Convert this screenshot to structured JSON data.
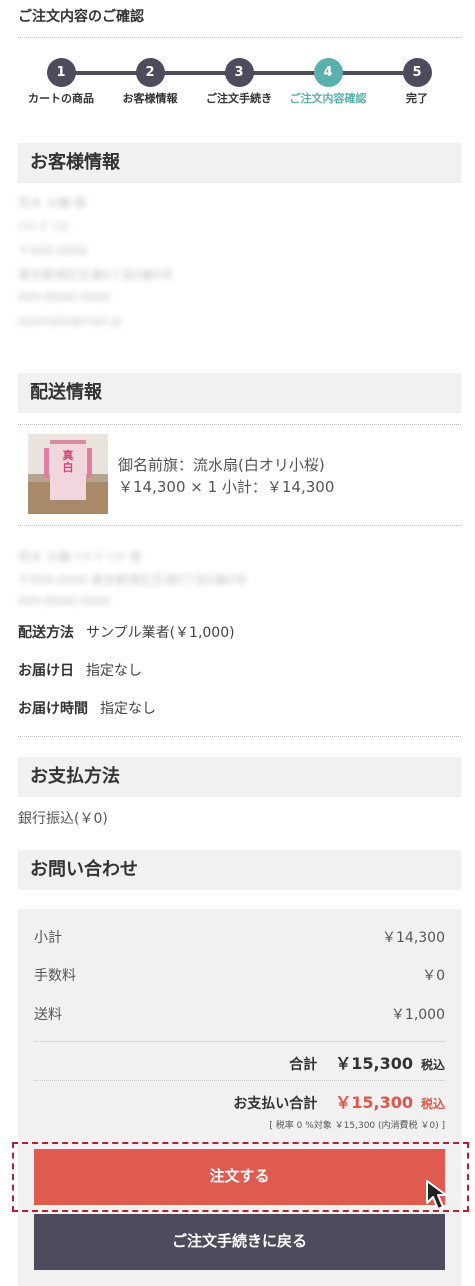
{
  "page": {
    "title": "ご注文内容のご確認"
  },
  "steps": [
    {
      "number": "1",
      "label": "カートの商品",
      "active": false
    },
    {
      "number": "2",
      "label": "お客様情報",
      "active": false
    },
    {
      "number": "3",
      "label": "ご注文手続き",
      "active": false
    },
    {
      "number": "4",
      "label": "ご注文内容確認",
      "active": true
    },
    {
      "number": "5",
      "label": "完了",
      "active": false
    }
  ],
  "customer": {
    "heading": "お客様情報",
    "lines": [
      "荒木 大輔 様",
      "ｱﾗｷ ﾀﾞｲｽｹ",
      "〒000-0000",
      "東京都港区芝浦0丁目0番0号",
      "000-0000-0000",
      "example@mail.jp"
    ]
  },
  "shipping": {
    "heading": "配送情報",
    "product_name": "御名前旗：流水扇(白オリ小桜)",
    "product_price_line": "￥14,300 × 1  小計：￥14,300",
    "product_image_text": "真白",
    "recipient_lines": [
      "荒木 大輔 ｱﾗｷ ﾀﾞｲｽｹ 様",
      "〒000-0000 東京都港区芝浦0丁目0番0号",
      "000-0000-0000"
    ],
    "method_label": "配送方法",
    "method_value": "サンプル業者(￥1,000)",
    "date_label": "お届け日",
    "date_value": "指定なし",
    "time_label": "お届け時間",
    "time_value": "指定なし"
  },
  "payment": {
    "heading": "お支払方法",
    "value": "銀行振込(￥0)"
  },
  "inquiry": {
    "heading": "お問い合わせ"
  },
  "summary": {
    "subtotal_label": "小計",
    "subtotal_value": "￥14,300",
    "fee_label": "手数料",
    "fee_value": "￥0",
    "shipping_label": "送料",
    "shipping_value": "￥1,000",
    "total_label": "合計",
    "total_value": "￥15,300",
    "tax_incl": "税込",
    "payment_total_label": "お支払い合計",
    "payment_total_value": "￥15,300",
    "payment_tax_incl": "税込",
    "tax_note": "[ 税率 0 %対象 ￥15,300 (内消費税 ￥0) ]"
  },
  "buttons": {
    "order": "注文する",
    "back": "ご注文手続きに戻る"
  },
  "colors": {
    "accent": "#5ab0ad",
    "step_dark": "#4d4b5c",
    "order_button": "#e05b4f",
    "back_button": "#4e4c5c",
    "price_red": "#e0564a"
  }
}
